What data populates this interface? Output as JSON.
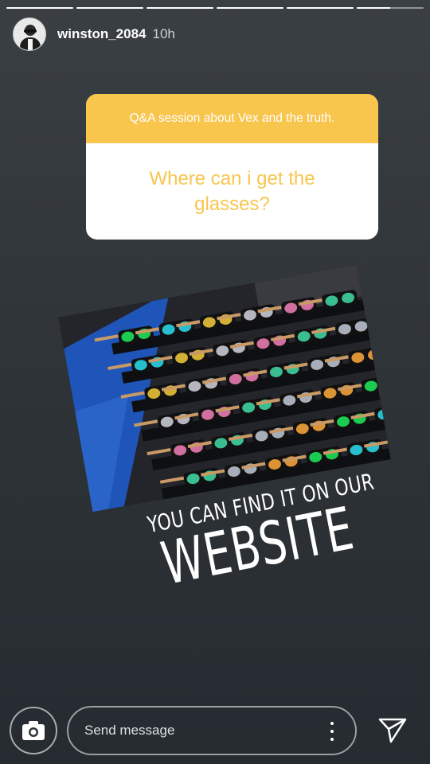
{
  "story": {
    "progress_segments": [
      1,
      1,
      1,
      1,
      1,
      0.5
    ],
    "username": "winston_2084",
    "time": "10h"
  },
  "question_sticker": {
    "prompt": "Q&A session about Vex and the truth.",
    "question": "Where can i get the glasses?",
    "accent_color": "#f8c54d"
  },
  "caption": {
    "line1": "YOU CAN FIND IT ON OUR",
    "line2": "WEBSITE"
  },
  "composer": {
    "placeholder": "Send message",
    "camera_icon": "camera-icon",
    "more_icon": "more-vertical-icon",
    "send_icon": "send-icon"
  }
}
